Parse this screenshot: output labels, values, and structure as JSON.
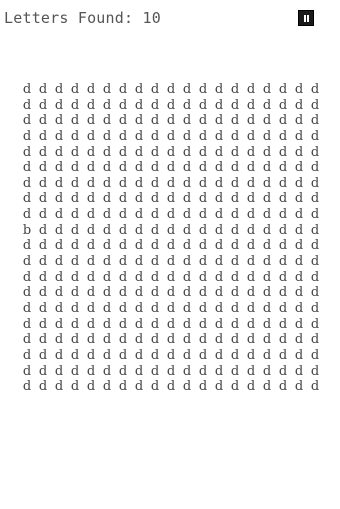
{
  "header": {
    "letters_found_label": "Letters Found:",
    "letters_found_count": "10"
  },
  "pause_button": {
    "icon": "pause-icon",
    "background_color": "#1a1a1a",
    "icon_color": "#ffffff"
  },
  "grid": {
    "rows": [
      [
        "d",
        "d",
        "d",
        "d",
        "d",
        "d",
        "d",
        "d",
        "d",
        "d",
        "d",
        "d",
        "d",
        "d",
        "d",
        "d",
        "d",
        "d",
        "d"
      ],
      [
        "d",
        "d",
        "d",
        "d",
        "d",
        "d",
        "d",
        "d",
        "d",
        "d",
        "d",
        "d",
        "d",
        "d",
        "d",
        "d",
        "d",
        "d",
        "d"
      ],
      [
        "d",
        "d",
        "d",
        "d",
        "d",
        "d",
        "d",
        "d",
        "d",
        "d",
        "d",
        "d",
        "d",
        "d",
        "d",
        "d",
        "d",
        "d",
        "d"
      ],
      [
        "d",
        "d",
        "d",
        "d",
        "d",
        "d",
        "d",
        "d",
        "d",
        "d",
        "d",
        "d",
        "d",
        "d",
        "d",
        "d",
        "d",
        "d",
        "d"
      ],
      [
        "d",
        "d",
        "d",
        "d",
        "d",
        "d",
        "d",
        "d",
        "d",
        "d",
        "d",
        "d",
        "d",
        "d",
        "d",
        "d",
        "d",
        "d",
        "d"
      ],
      [
        "d",
        "d",
        "d",
        "d",
        "d",
        "d",
        "d",
        "d",
        "d",
        "d",
        "d",
        "d",
        "d",
        "d",
        "d",
        "d",
        "d",
        "d",
        "d"
      ],
      [
        "d",
        "d",
        "d",
        "d",
        "d",
        "d",
        "d",
        "d",
        "d",
        "d",
        "d",
        "d",
        "d",
        "d",
        "d",
        "d",
        "d",
        "d",
        "d"
      ],
      [
        "d",
        "d",
        "d",
        "d",
        "d",
        "d",
        "d",
        "d",
        "d",
        "d",
        "d",
        "d",
        "d",
        "d",
        "d",
        "d",
        "d",
        "d",
        "d"
      ],
      [
        "d",
        "d",
        "d",
        "d",
        "d",
        "d",
        "d",
        "d",
        "d",
        "d",
        "d",
        "d",
        "d",
        "d",
        "d",
        "d",
        "d",
        "d",
        "d"
      ],
      [
        "b",
        "d",
        "d",
        "d",
        "d",
        "d",
        "d",
        "d",
        "d",
        "d",
        "d",
        "d",
        "d",
        "d",
        "d",
        "d",
        "d",
        "d",
        "d"
      ],
      [
        "d",
        "d",
        "d",
        "d",
        "d",
        "d",
        "d",
        "d",
        "d",
        "d",
        "d",
        "d",
        "d",
        "d",
        "d",
        "d",
        "d",
        "d",
        "d"
      ],
      [
        "d",
        "d",
        "d",
        "d",
        "d",
        "d",
        "d",
        "d",
        "d",
        "d",
        "d",
        "d",
        "d",
        "d",
        "d",
        "d",
        "d",
        "d",
        "d"
      ],
      [
        "d",
        "d",
        "d",
        "d",
        "d",
        "d",
        "d",
        "d",
        "d",
        "d",
        "d",
        "d",
        "d",
        "d",
        "d",
        "d",
        "d",
        "d",
        "d"
      ],
      [
        "d",
        "d",
        "d",
        "d",
        "d",
        "d",
        "d",
        "d",
        "d",
        "d",
        "d",
        "d",
        "d",
        "d",
        "d",
        "d",
        "d",
        "d",
        "d"
      ],
      [
        "d",
        "d",
        "d",
        "d",
        "d",
        "d",
        "d",
        "d",
        "d",
        "d",
        "d",
        "d",
        "d",
        "d",
        "d",
        "d",
        "d",
        "d",
        "d"
      ],
      [
        "d",
        "d",
        "d",
        "d",
        "d",
        "d",
        "d",
        "d",
        "d",
        "d",
        "d",
        "d",
        "d",
        "d",
        "d",
        "d",
        "d",
        "d",
        "d"
      ],
      [
        "d",
        "d",
        "d",
        "d",
        "d",
        "d",
        "d",
        "d",
        "d",
        "d",
        "d",
        "d",
        "d",
        "d",
        "d",
        "d",
        "d",
        "d",
        "d"
      ],
      [
        "d",
        "d",
        "d",
        "d",
        "d",
        "d",
        "d",
        "d",
        "d",
        "d",
        "d",
        "d",
        "d",
        "d",
        "d",
        "d",
        "d",
        "d",
        "d"
      ],
      [
        "d",
        "d",
        "d",
        "d",
        "d",
        "d",
        "d",
        "d",
        "d",
        "d",
        "d",
        "d",
        "d",
        "d",
        "d",
        "d",
        "d",
        "d",
        "d"
      ],
      [
        "d",
        "d",
        "d",
        "d",
        "d",
        "d",
        "d",
        "d",
        "d",
        "d",
        "d",
        "d",
        "d",
        "d",
        "d",
        "d",
        "d",
        "d",
        "d"
      ]
    ]
  }
}
